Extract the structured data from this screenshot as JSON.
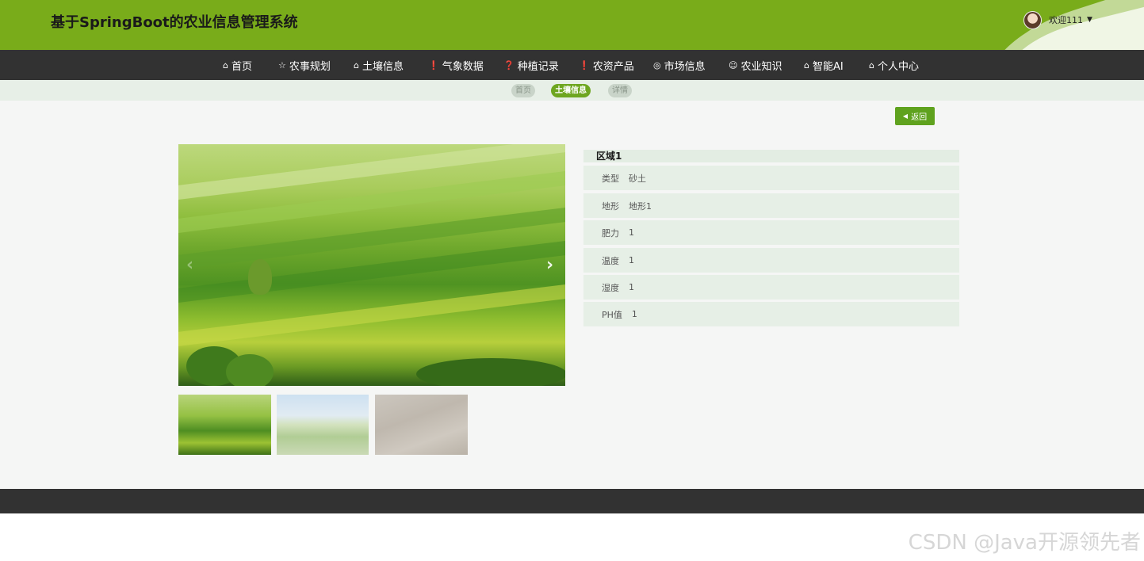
{
  "header": {
    "title": "基于SpringBoot的农业信息管理系统",
    "welcome": "欢迎111",
    "caret": "▼",
    "accent": "#79ac1a"
  },
  "nav": {
    "items": [
      {
        "icon": "⌂",
        "label": "首页"
      },
      {
        "icon": "☆",
        "label": "农事规划"
      },
      {
        "icon": "⌂",
        "label": "土壤信息"
      },
      {
        "icon": "❗",
        "label": "气象数据"
      },
      {
        "icon": "❓",
        "label": "种植记录"
      },
      {
        "icon": "❗",
        "label": "农资产品"
      },
      {
        "icon": "◎",
        "label": "市场信息"
      },
      {
        "icon": "☺",
        "label": "农业知识"
      },
      {
        "icon": "⌂",
        "label": "智能AI"
      },
      {
        "icon": "⌂",
        "label": "个人中心"
      }
    ],
    "background": "#323232"
  },
  "breadcrumb": {
    "items": [
      "首页",
      "土壤信息",
      "详情"
    ],
    "active_index": 1
  },
  "actions": {
    "back_icon": "◀",
    "back_label": "返回"
  },
  "carousel": {
    "prev": "‹",
    "next": "›",
    "thumbnails": [
      "field",
      "crop-rows",
      "soil"
    ]
  },
  "detail": {
    "title": "区域1",
    "rows": [
      {
        "label": "类型",
        "value": "砂土"
      },
      {
        "label": "地形",
        "value": "地形1"
      },
      {
        "label": "肥力",
        "value": "1"
      },
      {
        "label": "温度",
        "value": "1"
      },
      {
        "label": "湿度",
        "value": "1"
      },
      {
        "label": "PH值",
        "value": "1"
      }
    ]
  },
  "watermark": "CSDN @Java开源领先者"
}
